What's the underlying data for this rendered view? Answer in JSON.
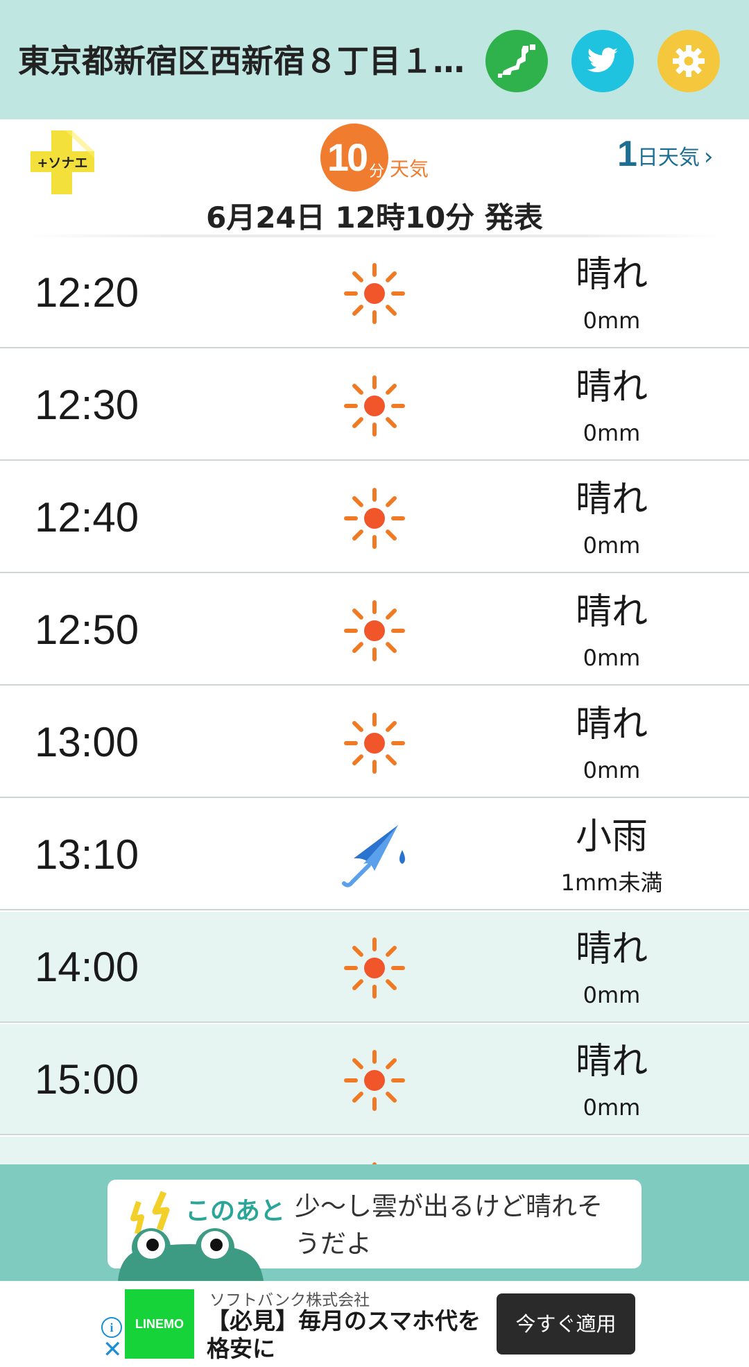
{
  "header": {
    "location": "東京都新宿区西新宿８丁目１…",
    "map_icon": "japan-map-icon",
    "twitter_icon": "twitter-bird-icon",
    "settings_icon": "gear-icon",
    "colors": {
      "bg": "#bfe6e0",
      "map_btn": "#2fb24b",
      "twitter_btn": "#1fc3e0",
      "settings_btn": "#f5c73c"
    }
  },
  "subheader": {
    "sonae_logo_text": "+ソナエ",
    "badge_number": "10",
    "badge_unit": "分",
    "badge_suffix": "天気",
    "oneday_num": "1",
    "oneday_label": "日天気",
    "oneday_chevron": "›",
    "announcement": "6月24日 12時10分 発表"
  },
  "forecast": [
    {
      "time": "12:20",
      "icon": "sun-icon",
      "condition": "晴れ",
      "amount": "0mm",
      "hourly": false
    },
    {
      "time": "12:30",
      "icon": "sun-icon",
      "condition": "晴れ",
      "amount": "0mm",
      "hourly": false
    },
    {
      "time": "12:40",
      "icon": "sun-icon",
      "condition": "晴れ",
      "amount": "0mm",
      "hourly": false
    },
    {
      "time": "12:50",
      "icon": "sun-icon",
      "condition": "晴れ",
      "amount": "0mm",
      "hourly": false
    },
    {
      "time": "13:00",
      "icon": "sun-icon",
      "condition": "晴れ",
      "amount": "0mm",
      "hourly": false
    },
    {
      "time": "13:10",
      "icon": "umbrella-rain-icon",
      "condition": "小雨",
      "amount": "1mm未満",
      "hourly": false
    },
    {
      "time": "14:00",
      "icon": "sun-icon",
      "condition": "晴れ",
      "amount": "0mm",
      "hourly": true
    },
    {
      "time": "15:00",
      "icon": "sun-icon",
      "condition": "晴れ",
      "amount": "0mm",
      "hourly": true
    },
    {
      "time": "",
      "icon": "sun-icon",
      "condition": "",
      "amount": "",
      "hourly": true
    }
  ],
  "comment": {
    "label": "このあと",
    "message": "少〜し雲が出るけど晴れそうだよ"
  },
  "ad": {
    "logo_text": "LINEMO",
    "sponsor": "ソフトバンク株式会社",
    "headline": "【必見】毎月のスマホ代を格安に",
    "cta": "今すぐ適用",
    "info_glyph": "i",
    "close_glyph": "✕"
  }
}
